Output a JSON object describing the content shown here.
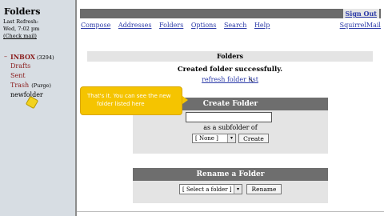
{
  "sidebar": {
    "title": "Folders",
    "last_refresh_label": "Last Refresh:",
    "last_refresh_value": "Wed, 7:02 pm",
    "check_mail": "(Check mail)",
    "inbox_arrow": "–",
    "folders": [
      {
        "name": "INBOX",
        "count": "(3294)"
      },
      {
        "name": "Drafts"
      },
      {
        "name": "Sent"
      },
      {
        "name": "Trash",
        "action": "(Purge)"
      },
      {
        "name": "newfolder"
      }
    ]
  },
  "header": {
    "sign_out": "Sign Out",
    "nav": [
      "Compose",
      "Addresses",
      "Folders",
      "Options",
      "Search",
      "Help"
    ],
    "brand": "SquirrelMail"
  },
  "folders_panel": {
    "title": "Folders",
    "message": "Created folder successfully.",
    "refresh_link": "refresh folder list"
  },
  "create_folder": {
    "title": "Create Folder",
    "input_value": "",
    "subfolder_label": "as a subfolder of",
    "parent_select": "[ None ]",
    "button": "Create"
  },
  "rename_folder": {
    "title": "Rename a Folder",
    "select": "[ Select a folder ]",
    "button": "Rename"
  },
  "tooltip": {
    "line1": "That's it. You can see the new",
    "line2": "folder listed here"
  },
  "icons": {
    "dropdown_arrow": "▾",
    "cursor": "↖"
  },
  "colors": {
    "link": "#2b3aa8",
    "folder": "#8b1e1e",
    "callout": "#f5c400"
  }
}
